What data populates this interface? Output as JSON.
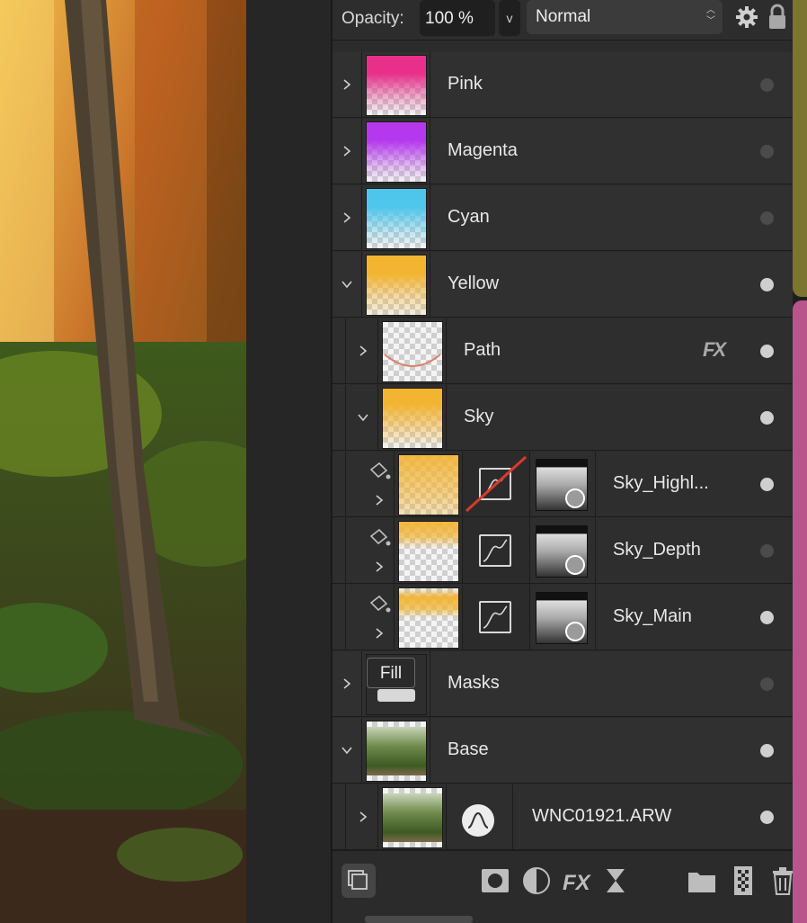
{
  "toolbar": {
    "opacity_label": "Opacity:",
    "opacity_value": "100 %",
    "opacity_stepper": "v",
    "blend_mode": "Normal"
  },
  "layers": [
    {
      "name": "Pink",
      "expanded": false,
      "visible": false,
      "tint": "#e8308a"
    },
    {
      "name": "Magenta",
      "expanded": false,
      "visible": false,
      "tint": "#b537ee"
    },
    {
      "name": "Cyan",
      "expanded": false,
      "visible": false,
      "tint": "#4ec6ec"
    },
    {
      "name": "Yellow",
      "expanded": true,
      "visible": true,
      "tint": "#f3b431"
    },
    {
      "name": "Path",
      "expanded": false,
      "visible": true,
      "fx": "FX"
    },
    {
      "name": "Sky",
      "expanded": true,
      "visible": true,
      "tint": "#f3b431"
    },
    {
      "name": "Sky_Highl...",
      "visible": true,
      "disabled_adjust": true
    },
    {
      "name": "Sky_Depth",
      "visible": false
    },
    {
      "name": "Sky_Main",
      "visible": true
    },
    {
      "name": "Masks",
      "expanded": false,
      "visible": false
    },
    {
      "name": "Base",
      "expanded": true,
      "visible": true
    },
    {
      "name": "WNC01921.ARW",
      "expanded": false,
      "visible": true
    }
  ],
  "tooltip": "Fill",
  "colors": {
    "accent_yellow": "#7c7431",
    "accent_pink": "#b9558a",
    "disabled_line": "#d83a2c"
  }
}
